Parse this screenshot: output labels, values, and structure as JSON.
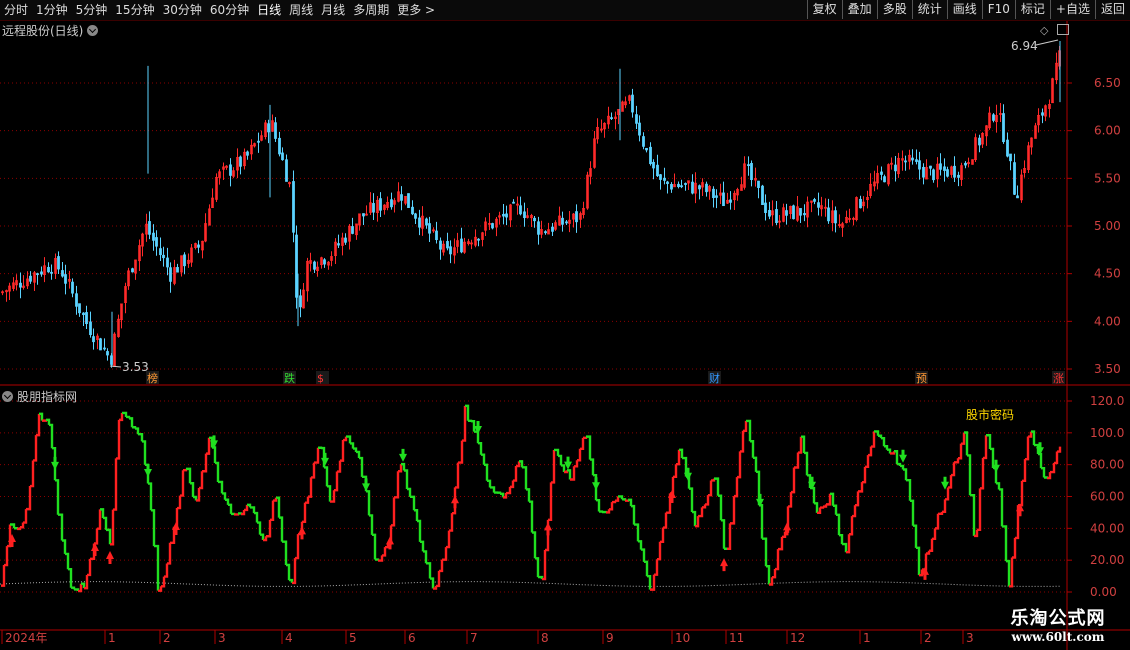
{
  "toolbar": {
    "periods": [
      "分时",
      "1分钟",
      "5分钟",
      "15分钟",
      "30分钟",
      "60分钟",
      "日线",
      "周线",
      "月线",
      "多周期",
      "更多 >"
    ],
    "active_period": "日线",
    "buttons": [
      "复权",
      "叠加",
      "多股",
      "统计",
      "画线",
      "F10",
      "标记",
      "+自选",
      "返回"
    ]
  },
  "main_panel": {
    "title": "远程股份(日线)",
    "high_label": "6.94",
    "low_label": "3.53",
    "y_ticks": [
      "6.50",
      "6.00",
      "5.50",
      "5.00",
      "4.50",
      "4.00",
      "3.50"
    ],
    "events": [
      {
        "label": "榜",
        "color": "#ff9933"
      },
      {
        "label": "跌",
        "color": "#33dd33"
      },
      {
        "label": "$",
        "color": "#ff3333"
      },
      {
        "label": "财",
        "color": "#3399ff"
      },
      {
        "label": "预",
        "color": "#ff9933"
      },
      {
        "label": "涨",
        "color": "#ff3333"
      }
    ]
  },
  "indicator_panel": {
    "title": "股朋指标网",
    "note": "股市密码",
    "y_ticks": [
      "120.0",
      "100.0",
      "80.00",
      "60.00",
      "40.00",
      "20.00",
      "0.00"
    ]
  },
  "x_axis": {
    "labels": [
      "2024年",
      "1",
      "2",
      "3",
      "4",
      "5",
      "6",
      "7",
      "8",
      "9",
      "10",
      "11",
      "12",
      "1",
      "2",
      "3"
    ]
  },
  "watermark": {
    "title": "乐淘公式网",
    "url": "www.60lt.com"
  },
  "colors": {
    "up": "#ff2a2a",
    "down": "#5bd3ff",
    "ind_up": "#ff2020",
    "ind_down": "#20e020",
    "grid": "#8b0000",
    "axis": "#b00000"
  }
}
